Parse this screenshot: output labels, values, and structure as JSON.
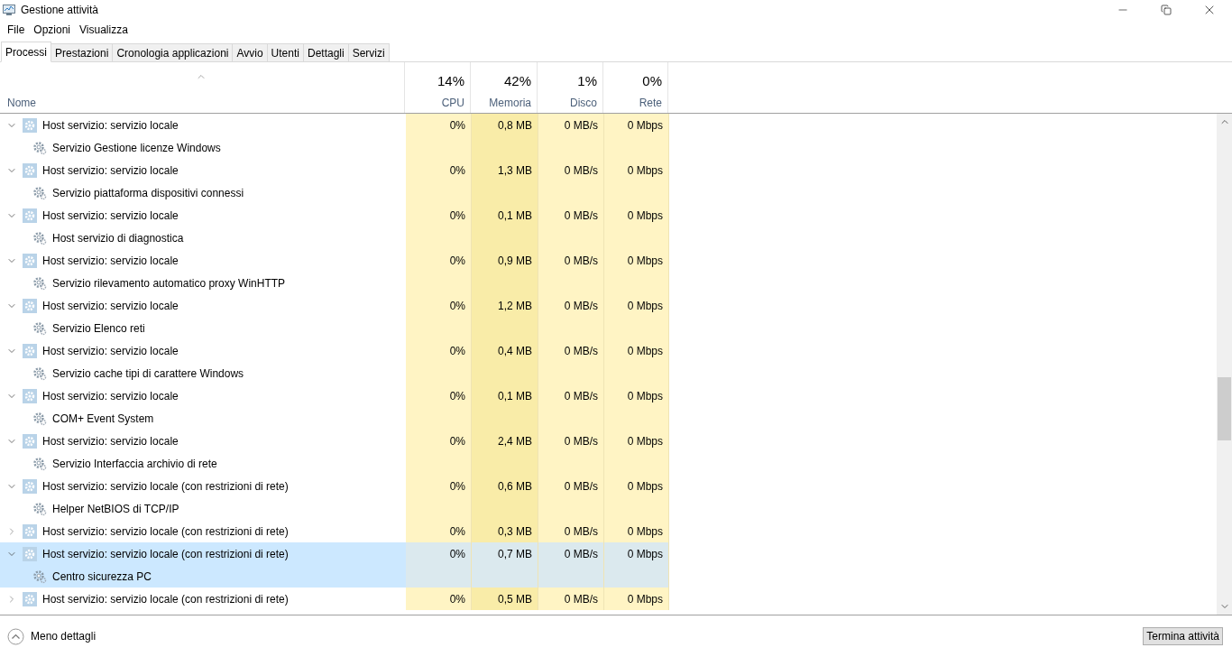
{
  "window": {
    "title": "Gestione attività"
  },
  "menu": [
    "File",
    "Opzioni",
    "Visualizza"
  ],
  "tabs": [
    {
      "label": "Processi",
      "selected": true
    },
    {
      "label": "Prestazioni",
      "selected": false
    },
    {
      "label": "Cronologia applicazioni",
      "selected": false
    },
    {
      "label": "Avvio",
      "selected": false
    },
    {
      "label": "Utenti",
      "selected": false
    },
    {
      "label": "Dettagli",
      "selected": false
    },
    {
      "label": "Servizi",
      "selected": false
    }
  ],
  "table": {
    "name_column": "Nome",
    "columns": [
      {
        "percent": "14%",
        "label": "CPU"
      },
      {
        "percent": "42%",
        "label": "Memoria"
      },
      {
        "percent": "1%",
        "label": "Disco"
      },
      {
        "percent": "0%",
        "label": "Rete"
      }
    ],
    "rows": [
      {
        "name": "Host servizio: servizio locale",
        "expanded": true,
        "selected": false,
        "values": [
          "0%",
          "0,8 MB",
          "0 MB/s",
          "0 Mbps"
        ],
        "children": [
          {
            "name": "Servizio Gestione licenze Windows"
          }
        ]
      },
      {
        "name": "Host servizio: servizio locale",
        "expanded": true,
        "selected": false,
        "values": [
          "0%",
          "1,3 MB",
          "0 MB/s",
          "0 Mbps"
        ],
        "children": [
          {
            "name": "Servizio piattaforma dispositivi connessi"
          }
        ]
      },
      {
        "name": "Host servizio: servizio locale",
        "expanded": true,
        "selected": false,
        "values": [
          "0%",
          "0,1 MB",
          "0 MB/s",
          "0 Mbps"
        ],
        "children": [
          {
            "name": "Host servizio di diagnostica"
          }
        ]
      },
      {
        "name": "Host servizio: servizio locale",
        "expanded": true,
        "selected": false,
        "values": [
          "0%",
          "0,9 MB",
          "0 MB/s",
          "0 Mbps"
        ],
        "children": [
          {
            "name": "Servizio rilevamento automatico proxy WinHTTP"
          }
        ]
      },
      {
        "name": "Host servizio: servizio locale",
        "expanded": true,
        "selected": false,
        "values": [
          "0%",
          "1,2 MB",
          "0 MB/s",
          "0 Mbps"
        ],
        "children": [
          {
            "name": "Servizio Elenco reti"
          }
        ]
      },
      {
        "name": "Host servizio: servizio locale",
        "expanded": true,
        "selected": false,
        "values": [
          "0%",
          "0,4 MB",
          "0 MB/s",
          "0 Mbps"
        ],
        "children": [
          {
            "name": "Servizio cache tipi di carattere Windows"
          }
        ]
      },
      {
        "name": "Host servizio: servizio locale",
        "expanded": true,
        "selected": false,
        "values": [
          "0%",
          "0,1 MB",
          "0 MB/s",
          "0 Mbps"
        ],
        "children": [
          {
            "name": "COM+ Event System"
          }
        ]
      },
      {
        "name": "Host servizio: servizio locale",
        "expanded": true,
        "selected": false,
        "values": [
          "0%",
          "2,4 MB",
          "0 MB/s",
          "0 Mbps"
        ],
        "children": [
          {
            "name": "Servizio Interfaccia archivio di rete"
          }
        ]
      },
      {
        "name": "Host servizio: servizio locale (con restrizioni di rete)",
        "expanded": true,
        "selected": false,
        "values": [
          "0%",
          "0,6 MB",
          "0 MB/s",
          "0 Mbps"
        ],
        "children": [
          {
            "name": "Helper NetBIOS di TCP/IP"
          }
        ]
      },
      {
        "name": "Host servizio: servizio locale (con restrizioni di rete)",
        "expanded": false,
        "selected": false,
        "values": [
          "0%",
          "0,3 MB",
          "0 MB/s",
          "0 Mbps"
        ]
      },
      {
        "name": "Host servizio: servizio locale (con restrizioni di rete)",
        "expanded": true,
        "selected": true,
        "values": [
          "0%",
          "0,7 MB",
          "0 MB/s",
          "0 Mbps"
        ],
        "children": [
          {
            "name": "Centro sicurezza PC"
          }
        ]
      },
      {
        "name": "Host servizio: servizio locale (con restrizioni di rete)",
        "expanded": false,
        "selected": false,
        "values": [
          "0%",
          "0,5 MB",
          "0 MB/s",
          "0 Mbps"
        ]
      }
    ]
  },
  "footer": {
    "toggle": "Meno dettagli",
    "button": "Termina attività"
  }
}
